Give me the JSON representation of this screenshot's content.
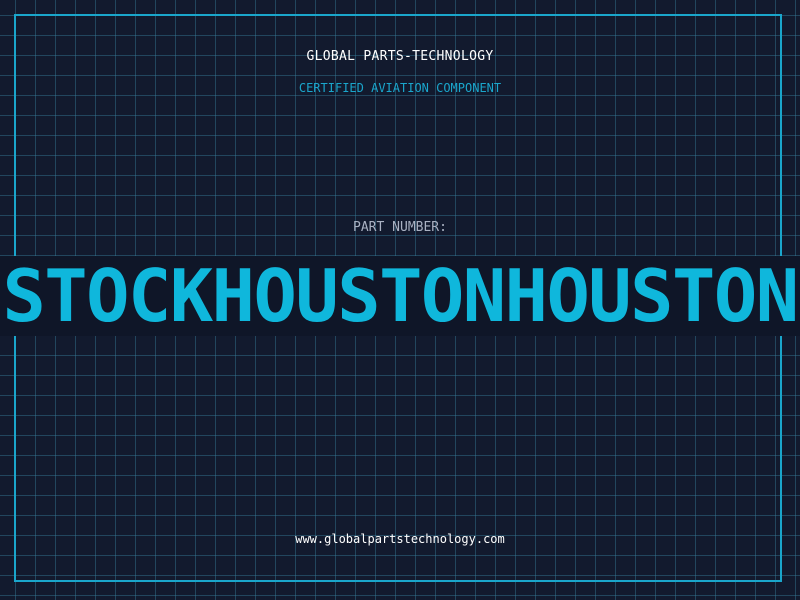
{
  "header": {
    "company": "GLOBAL PARTS-TECHNOLOGY",
    "subtitle": "CERTIFIED AVIATION COMPONENT"
  },
  "part": {
    "label": "PART NUMBER:",
    "number": "STOCKHOUSTONHOUSTON"
  },
  "footer": {
    "website": "www.globalpartstechnology.com"
  },
  "colors": {
    "background": "#121a2e",
    "accent": "#0fb7dc",
    "grid": "#2b6f8a",
    "label": "#a9b1c2",
    "text": "#ffffff"
  }
}
